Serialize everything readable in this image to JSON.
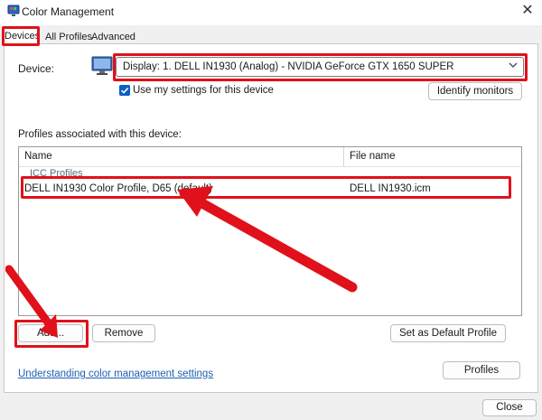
{
  "window": {
    "title": "Color Management",
    "close_glyph": "✕"
  },
  "tabs": [
    {
      "label": "Devices"
    },
    {
      "label": "All Profiles"
    },
    {
      "label": "Advanced"
    }
  ],
  "device": {
    "label": "Device:",
    "selected": "Display: 1. DELL IN1930 (Analog) - NVIDIA GeForce GTX 1650 SUPER",
    "use_my_settings_label": "Use my settings for this device",
    "use_my_settings_checked": true,
    "identify_label": "Identify monitors"
  },
  "profiles": {
    "label": "Profiles associated with this device:",
    "columns": {
      "name": "Name",
      "file": "File name"
    },
    "group": "ICC Profiles",
    "rows": [
      {
        "name": "DELL IN1930 Color Profile, D65 (default)",
        "file": "DELL IN1930.icm"
      }
    ]
  },
  "buttons": {
    "add": "Add...",
    "remove": "Remove",
    "set_default": "Set as Default Profile",
    "profiles": "Profiles",
    "close": "Close"
  },
  "link": "Understanding color management settings",
  "colors": {
    "highlight": "#e0111b",
    "accent": "#0a5fc4",
    "link": "#1f5fb3"
  },
  "icons": {
    "app": "color-management-icon",
    "monitor": "monitor-icon",
    "dropdown": "chevron-down-icon",
    "annotation": "red-arrow-icon"
  }
}
